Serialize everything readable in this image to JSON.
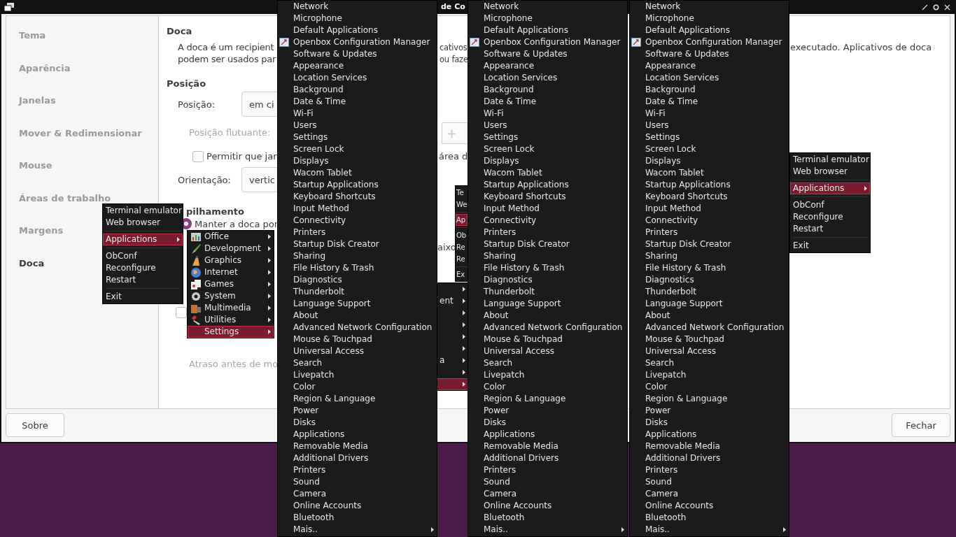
{
  "window": {
    "title": "de Co"
  },
  "sidebar": {
    "items": [
      {
        "label": "Tema",
        "selected": false
      },
      {
        "label": "Aparência",
        "selected": false
      },
      {
        "label": "Janelas",
        "selected": false
      },
      {
        "label": "Mover & Redimensionar",
        "selected": false
      },
      {
        "label": "Mouse",
        "selected": false
      },
      {
        "label": "Áreas de trabalho",
        "selected": false
      },
      {
        "label": "Margens",
        "selected": false
      },
      {
        "label": "Doca",
        "selected": true
      }
    ]
  },
  "content": {
    "title": "Doca",
    "description": {
      "line_1": {
        "left": "A doca é um recipient",
        "middle": "cativos",
        "right": "executado. Aplicativos de doca"
      },
      "line_2": {
        "left": "podem ser usados par",
        "middle": "ou faze"
      }
    },
    "position_heading": "Posição",
    "position_label": "Posição:",
    "position_value": "em ci",
    "floating_label": "Posição flutuante:",
    "floating_plus": "+",
    "allow_checkbox": {
      "checked": false,
      "label": "Permitir que jan",
      "label_tail": "área d"
    },
    "orientation_label": "Orientação:",
    "orientation_value": "vertic",
    "stacking_heading": "pilhamento",
    "keep_radio": {
      "selected": true,
      "label": "Manter a doca por"
    },
    "below_fragment": "aixo",
    "second_checkbox": {
      "checked": false
    },
    "delay_label": "Atraso antes de mo"
  },
  "buttons": {
    "about": "Sobre",
    "close": "Fechar"
  },
  "root_menus": [
    {
      "items": [
        {
          "kind": "item",
          "label": "Terminal emulator",
          "selected": false
        },
        {
          "kind": "item",
          "label": "Web browser",
          "selected": false
        },
        {
          "kind": "separator"
        },
        {
          "kind": "submenu",
          "label": "Applications",
          "selected": true
        },
        {
          "kind": "separator"
        },
        {
          "kind": "item",
          "label": "ObConf",
          "selected": false
        },
        {
          "kind": "item",
          "label": "Reconfigure",
          "selected": false
        },
        {
          "kind": "item",
          "label": "Restart",
          "selected": false
        },
        {
          "kind": "separator"
        },
        {
          "kind": "item",
          "label": "Exit",
          "selected": false
        }
      ]
    },
    {
      "items": [
        {
          "kind": "item",
          "label": "Te",
          "selected": false
        },
        {
          "kind": "item",
          "label": "We",
          "selected": false
        },
        {
          "kind": "separator"
        },
        {
          "kind": "item",
          "label": "Ap",
          "selected": true
        },
        {
          "kind": "separator"
        },
        {
          "kind": "item",
          "label": "Ob",
          "selected": false
        },
        {
          "kind": "item",
          "label": "Re",
          "selected": false
        },
        {
          "kind": "item",
          "label": "Re",
          "selected": false
        },
        {
          "kind": "separator"
        },
        {
          "kind": "item",
          "label": "Ex",
          "selected": false
        }
      ]
    },
    {
      "items": [
        {
          "kind": "item",
          "label": "Terminal emulator",
          "selected": false
        },
        {
          "kind": "item",
          "label": "Web browser",
          "selected": false
        },
        {
          "kind": "separator"
        },
        {
          "kind": "submenu",
          "label": "Applications",
          "selected": true
        },
        {
          "kind": "separator"
        },
        {
          "kind": "item",
          "label": "ObConf",
          "selected": false
        },
        {
          "kind": "item",
          "label": "Reconfigure",
          "selected": false
        },
        {
          "kind": "item",
          "label": "Restart",
          "selected": false
        },
        {
          "kind": "separator"
        },
        {
          "kind": "item",
          "label": "Exit",
          "selected": false
        }
      ]
    }
  ],
  "applications_menus": [
    {
      "items": [
        {
          "label": "Office",
          "selected": false
        },
        {
          "label": "Development",
          "selected": false
        },
        {
          "label": "Graphics",
          "selected": false
        },
        {
          "label": "Internet",
          "selected": false
        },
        {
          "label": "Games",
          "selected": false
        },
        {
          "label": "System",
          "selected": false
        },
        {
          "label": "Multimedia",
          "selected": false
        },
        {
          "label": "Utilities",
          "selected": false
        },
        {
          "label": "Settings",
          "selected": true
        }
      ]
    },
    {
      "items": [
        {
          "selected": false
        },
        {
          "label": "ent",
          "selected": false
        },
        {
          "selected": false
        },
        {
          "selected": false
        },
        {
          "selected": false
        },
        {
          "selected": false
        },
        {
          "label": "a",
          "selected": false
        },
        {
          "selected": false
        },
        {
          "selected": true
        }
      ]
    }
  ],
  "settings_menus": [
    {
      "items": [
        {
          "kind": "item",
          "label": "Network"
        },
        {
          "kind": "item",
          "label": "Microphone"
        },
        {
          "kind": "item",
          "label": "Default Applications"
        },
        {
          "kind": "icon_item",
          "label": "Openbox Configuration Manager"
        },
        {
          "kind": "item",
          "label": "Software & Updates"
        },
        {
          "kind": "item",
          "label": "Appearance"
        },
        {
          "kind": "item",
          "label": "Location Services"
        },
        {
          "kind": "item",
          "label": "Background"
        },
        {
          "kind": "item",
          "label": "Date & Time"
        },
        {
          "kind": "item",
          "label": "Wi-Fi"
        },
        {
          "kind": "item",
          "label": "Users"
        },
        {
          "kind": "item",
          "label": "Settings"
        },
        {
          "kind": "item",
          "label": "Screen Lock"
        },
        {
          "kind": "item",
          "label": "Displays"
        },
        {
          "kind": "item",
          "label": "Wacom Tablet"
        },
        {
          "kind": "item",
          "label": "Startup Applications"
        },
        {
          "kind": "item",
          "label": "Keyboard Shortcuts"
        },
        {
          "kind": "item",
          "label": "Input Method"
        },
        {
          "kind": "item",
          "label": "Connectivity"
        },
        {
          "kind": "item",
          "label": "Printers"
        },
        {
          "kind": "item",
          "label": "Startup Disk Creator"
        },
        {
          "kind": "item",
          "label": "Sharing"
        },
        {
          "kind": "item",
          "label": "File History & Trash"
        },
        {
          "kind": "item",
          "label": "Diagnostics"
        },
        {
          "kind": "item",
          "label": "Thunderbolt"
        },
        {
          "kind": "item",
          "label": "Language Support"
        },
        {
          "kind": "item",
          "label": "About"
        },
        {
          "kind": "item",
          "label": "Advanced Network Configuration"
        },
        {
          "kind": "item",
          "label": "Mouse & Touchpad"
        },
        {
          "kind": "item",
          "label": "Universal Access"
        },
        {
          "kind": "item",
          "label": "Search"
        },
        {
          "kind": "item",
          "label": "Livepatch"
        },
        {
          "kind": "item",
          "label": "Color"
        },
        {
          "kind": "item",
          "label": "Region & Language"
        },
        {
          "kind": "item",
          "label": "Power"
        },
        {
          "kind": "item",
          "label": "Disks"
        },
        {
          "kind": "item",
          "label": "Applications"
        },
        {
          "kind": "item",
          "label": "Removable Media"
        },
        {
          "kind": "item",
          "label": "Additional Drivers"
        },
        {
          "kind": "item",
          "label": "Printers"
        },
        {
          "kind": "item",
          "label": "Sound"
        },
        {
          "kind": "item",
          "label": "Camera"
        },
        {
          "kind": "item",
          "label": "Online Accounts"
        },
        {
          "kind": "item",
          "label": "Bluetooth"
        },
        {
          "kind": "submenu",
          "label": "Mais.."
        }
      ]
    },
    {
      "items": [
        {
          "kind": "item",
          "label": "Network"
        },
        {
          "kind": "item",
          "label": "Microphone"
        },
        {
          "kind": "item",
          "label": "Default Applications"
        },
        {
          "kind": "icon_item",
          "label": "Openbox Configuration Manager"
        },
        {
          "kind": "item",
          "label": "Software & Updates"
        },
        {
          "kind": "item",
          "label": "Appearance"
        },
        {
          "kind": "item",
          "label": "Location Services"
        },
        {
          "kind": "item",
          "label": "Background"
        },
        {
          "kind": "item",
          "label": "Date & Time"
        },
        {
          "kind": "item",
          "label": "Wi-Fi"
        },
        {
          "kind": "item",
          "label": "Users"
        },
        {
          "kind": "item",
          "label": "Settings"
        },
        {
          "kind": "item",
          "label": "Screen Lock"
        },
        {
          "kind": "item",
          "label": "Displays"
        },
        {
          "kind": "item",
          "label": "Wacom Tablet"
        },
        {
          "kind": "item",
          "label": "Startup Applications"
        },
        {
          "kind": "item",
          "label": "Keyboard Shortcuts"
        },
        {
          "kind": "item",
          "label": "Input Method"
        },
        {
          "kind": "item",
          "label": "Connectivity"
        },
        {
          "kind": "item",
          "label": "Printers"
        },
        {
          "kind": "item",
          "label": "Startup Disk Creator"
        },
        {
          "kind": "item",
          "label": "Sharing"
        },
        {
          "kind": "item",
          "label": "File History & Trash"
        },
        {
          "kind": "item",
          "label": "Diagnostics"
        },
        {
          "kind": "item",
          "label": "Thunderbolt"
        },
        {
          "kind": "item",
          "label": "Language Support"
        },
        {
          "kind": "item",
          "label": "About"
        },
        {
          "kind": "item",
          "label": "Advanced Network Configuration"
        },
        {
          "kind": "item",
          "label": "Mouse & Touchpad"
        },
        {
          "kind": "item",
          "label": "Universal Access"
        },
        {
          "kind": "item",
          "label": "Search"
        },
        {
          "kind": "item",
          "label": "Livepatch"
        },
        {
          "kind": "item",
          "label": "Color"
        },
        {
          "kind": "item",
          "label": "Region & Language"
        },
        {
          "kind": "item",
          "label": "Power"
        },
        {
          "kind": "item",
          "label": "Disks"
        },
        {
          "kind": "item",
          "label": "Applications"
        },
        {
          "kind": "item",
          "label": "Removable Media"
        },
        {
          "kind": "item",
          "label": "Additional Drivers"
        },
        {
          "kind": "item",
          "label": "Printers"
        },
        {
          "kind": "item",
          "label": "Sound"
        },
        {
          "kind": "item",
          "label": "Camera"
        },
        {
          "kind": "item",
          "label": "Online Accounts"
        },
        {
          "kind": "item",
          "label": "Bluetooth"
        },
        {
          "kind": "submenu",
          "label": "Mais.."
        }
      ]
    },
    {
      "items": [
        {
          "kind": "item",
          "label": "Network"
        },
        {
          "kind": "item",
          "label": "Microphone"
        },
        {
          "kind": "item",
          "label": "Default Applications"
        },
        {
          "kind": "icon_item",
          "label": "Openbox Configuration Manager"
        },
        {
          "kind": "item",
          "label": "Software & Updates"
        },
        {
          "kind": "item",
          "label": "Appearance"
        },
        {
          "kind": "item",
          "label": "Location Services"
        },
        {
          "kind": "item",
          "label": "Background"
        },
        {
          "kind": "item",
          "label": "Date & Time"
        },
        {
          "kind": "item",
          "label": "Wi-Fi"
        },
        {
          "kind": "item",
          "label": "Users"
        },
        {
          "kind": "item",
          "label": "Settings"
        },
        {
          "kind": "item",
          "label": "Screen Lock"
        },
        {
          "kind": "item",
          "label": "Displays"
        },
        {
          "kind": "item",
          "label": "Wacom Tablet"
        },
        {
          "kind": "item",
          "label": "Startup Applications"
        },
        {
          "kind": "item",
          "label": "Keyboard Shortcuts"
        },
        {
          "kind": "item",
          "label": "Input Method"
        },
        {
          "kind": "item",
          "label": "Connectivity"
        },
        {
          "kind": "item",
          "label": "Printers"
        },
        {
          "kind": "item",
          "label": "Startup Disk Creator"
        },
        {
          "kind": "item",
          "label": "Sharing"
        },
        {
          "kind": "item",
          "label": "File History & Trash"
        },
        {
          "kind": "item",
          "label": "Diagnostics"
        },
        {
          "kind": "item",
          "label": "Thunderbolt"
        },
        {
          "kind": "item",
          "label": "Language Support"
        },
        {
          "kind": "item",
          "label": "About"
        },
        {
          "kind": "item",
          "label": "Advanced Network Configuration"
        },
        {
          "kind": "item",
          "label": "Mouse & Touchpad"
        },
        {
          "kind": "item",
          "label": "Universal Access"
        },
        {
          "kind": "item",
          "label": "Search"
        },
        {
          "kind": "item",
          "label": "Livepatch"
        },
        {
          "kind": "item",
          "label": "Color"
        },
        {
          "kind": "item",
          "label": "Region & Language"
        },
        {
          "kind": "item",
          "label": "Power"
        },
        {
          "kind": "item",
          "label": "Disks"
        },
        {
          "kind": "item",
          "label": "Applications"
        },
        {
          "kind": "item",
          "label": "Removable Media"
        },
        {
          "kind": "item",
          "label": "Additional Drivers"
        },
        {
          "kind": "item",
          "label": "Printers"
        },
        {
          "kind": "item",
          "label": "Sound"
        },
        {
          "kind": "item",
          "label": "Camera"
        },
        {
          "kind": "item",
          "label": "Online Accounts"
        },
        {
          "kind": "item",
          "label": "Bluetooth"
        },
        {
          "kind": "submenu",
          "label": "Mais.."
        }
      ]
    }
  ]
}
